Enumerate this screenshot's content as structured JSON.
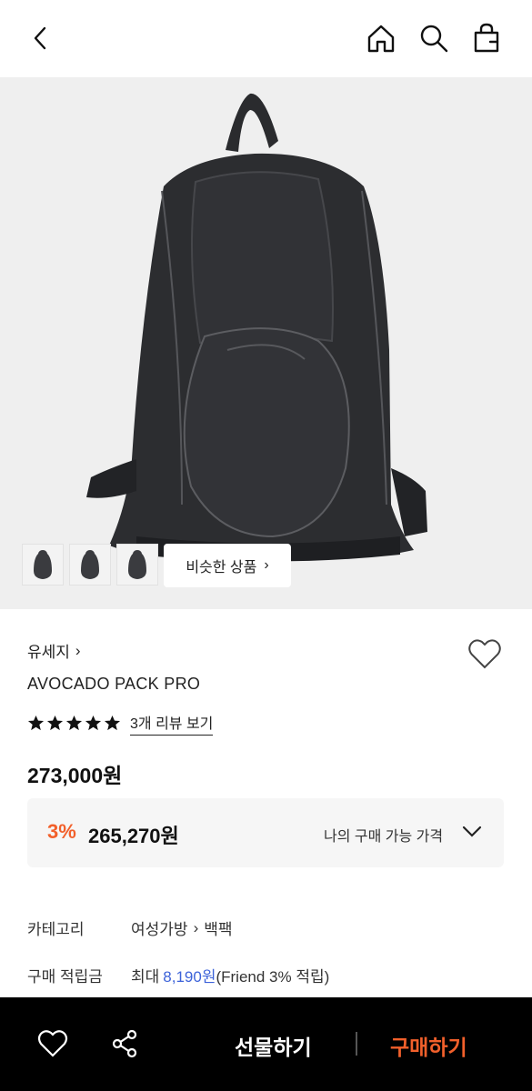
{
  "header": {
    "icons": [
      "back-arrow-icon",
      "home-icon",
      "search-icon",
      "shopping-bag-icon"
    ]
  },
  "gallery": {
    "thumbnail_count": 3,
    "similar_button_label": "비슷한 상품",
    "similar_button_chevron": "›"
  },
  "product": {
    "brand": "유세지",
    "brand_chevron": "›",
    "name": "AVOCADO PACK PRO",
    "rating_stars": 5,
    "review_link": "3개 리뷰 보기",
    "price": "273,000원"
  },
  "my_price": {
    "discount": "3%",
    "amount": "265,270원",
    "label": "나의 구매 가능 가격"
  },
  "details": {
    "category_label": "카테고리",
    "category_path_1": "여성가방",
    "category_separator": "›",
    "category_path_2": "백팩",
    "points_label": "구매 적립금",
    "points_prefix": "최대",
    "points_amount": "8,190원",
    "points_suffix": "(Friend 3% 적립)"
  },
  "bottom_bar": {
    "gift_label": "선물하기",
    "buy_label": "구매하기"
  },
  "colors": {
    "accent": "#f2602b",
    "link_blue": "#3d63d9",
    "bottom_bar_bg": "#000000"
  }
}
